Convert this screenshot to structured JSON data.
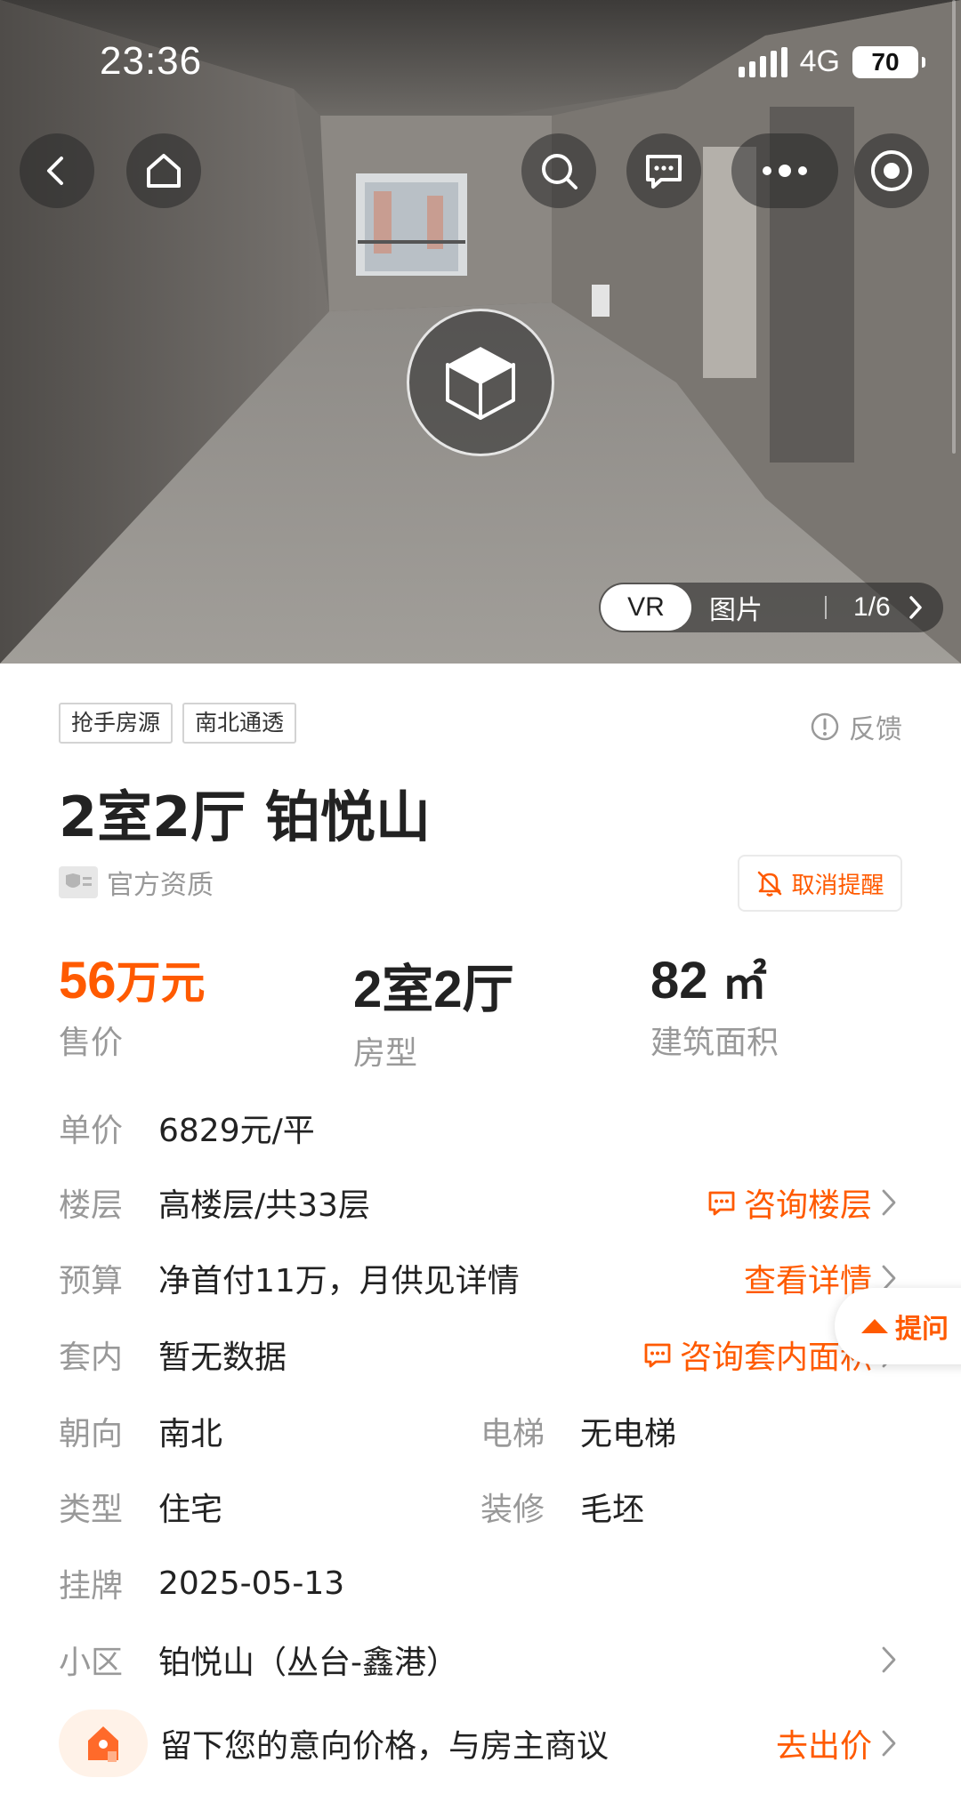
{
  "status_bar": {
    "time": "23:36",
    "network": "4G",
    "battery": "70"
  },
  "hero": {
    "icons": {
      "back": "chevron-left-icon",
      "home": "home-icon",
      "search": "search-icon",
      "message": "message-icon",
      "more": "more-dots-icon",
      "target": "target-icon",
      "vr": "cube-3d-icon"
    },
    "media_tabs": {
      "vr": "VR",
      "photos": "图片"
    },
    "counter": "1/6"
  },
  "tags": [
    "抢手房源",
    "南北通透"
  ],
  "feedback_label": "反馈",
  "title": "2室2厅 铂悦山",
  "official_label": "官方资质",
  "remind_button": "取消提醒",
  "stats": {
    "price_value": "56",
    "price_unit": "万元",
    "price_label": "售价",
    "layout_value": "2室2厅",
    "layout_label": "房型",
    "area_value": "82",
    "area_unit": "㎡",
    "area_label": "建筑面积"
  },
  "details": {
    "unit_price": {
      "key": "单价",
      "value": "6829元/平"
    },
    "floor": {
      "key": "楼层",
      "value": "高楼层/共33层",
      "action": "咨询楼层"
    },
    "budget": {
      "key": "预算",
      "value": "净首付11万，月供见详情",
      "action": "查看详情"
    },
    "inner_area": {
      "key": "套内",
      "value": "暂无数据",
      "action": "咨询套内面积"
    },
    "orientation": {
      "key": "朝向",
      "value": "南北"
    },
    "elevator": {
      "key": "电梯",
      "value": "无电梯"
    },
    "type": {
      "key": "类型",
      "value": "住宅"
    },
    "decoration": {
      "key": "装修",
      "value": "毛坯"
    },
    "listed": {
      "key": "挂牌",
      "value": "2025-05-13"
    },
    "community": {
      "key": "小区",
      "value": "铂悦山（丛台-鑫港）"
    }
  },
  "ask_button": "提问",
  "offer": {
    "text": "留下您的意向价格，与房主商议",
    "action": "去出价"
  },
  "colors": {
    "accent": "#ff5a00",
    "muted": "#999999",
    "text": "#222222"
  }
}
